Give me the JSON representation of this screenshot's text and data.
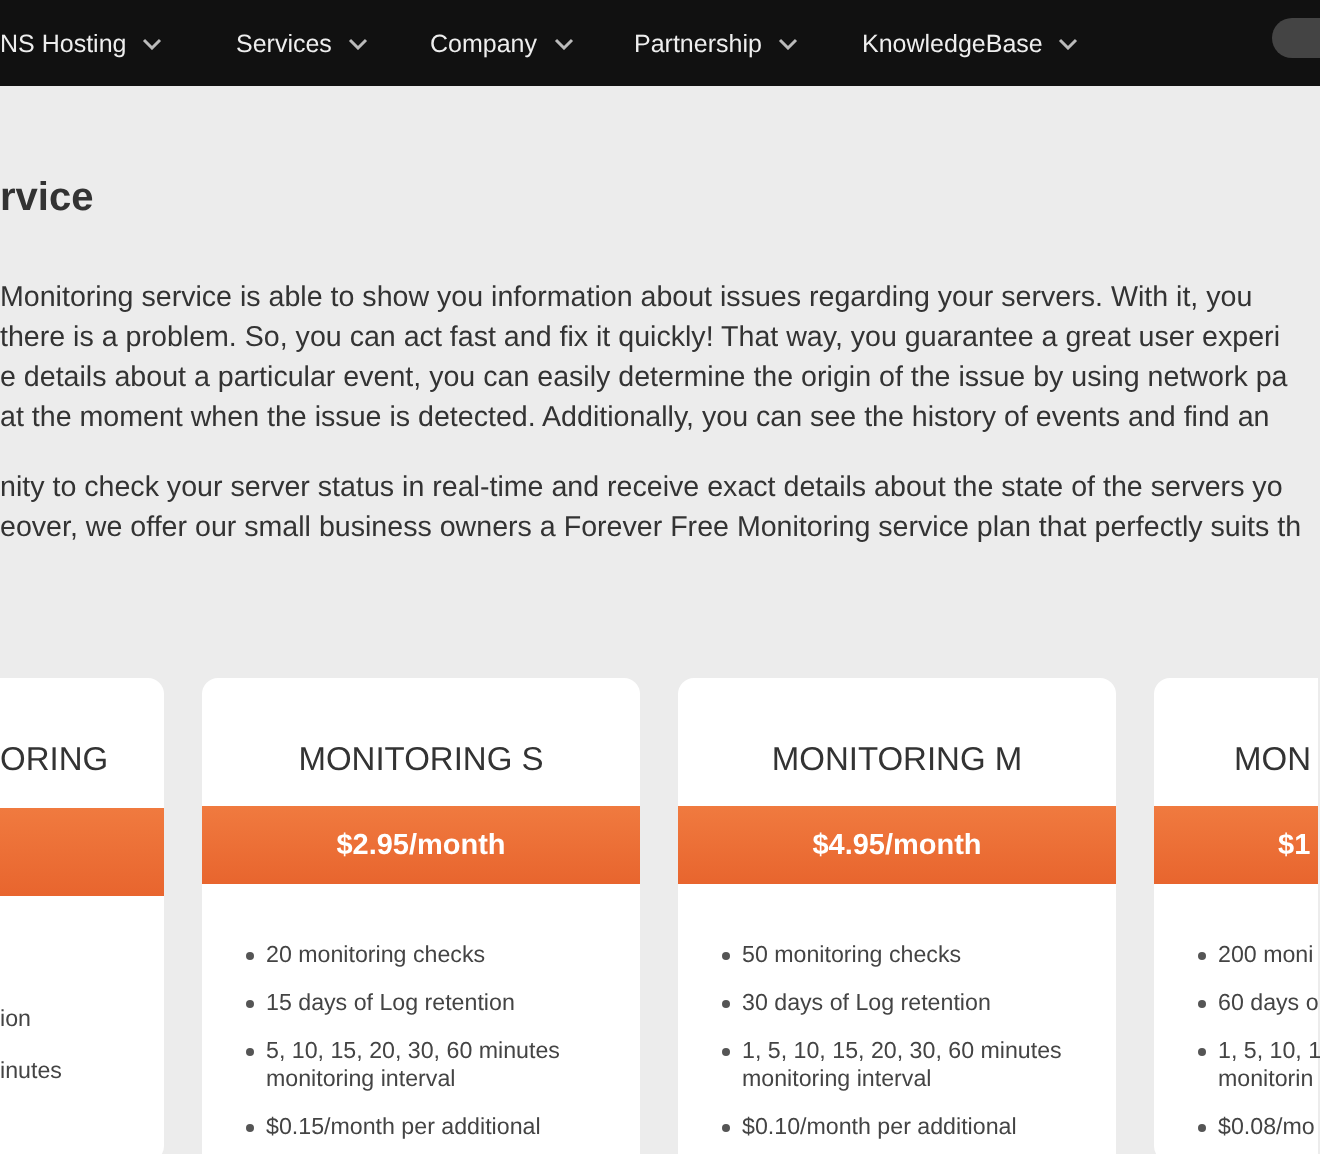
{
  "nav": {
    "items": [
      {
        "label": "NS Hosting"
      },
      {
        "label": "Services"
      },
      {
        "label": "Company"
      },
      {
        "label": "Partnership"
      },
      {
        "label": "KnowledgeBase"
      }
    ]
  },
  "page_title": "rvice",
  "paragraphs": [
    {
      "lines": [
        "Monitoring service is able to show you information about issues regarding your servers. With it, you",
        "there is a problem. So, you can act fast and fix it quickly! That way, you guarantee a great user experi",
        "e details about a particular event, you can easily determine the origin of the issue by using network pa",
        "at the moment when the issue is detected. Additionally, you can see the history of events and find an"
      ]
    },
    {
      "lines": [
        "nity to check your server status in real-time and receive exact details about the state of the servers yo",
        "eover, we offer our small business owners a Forever Free Monitoring service plan that perfectly suits th"
      ]
    }
  ],
  "plans": [
    {
      "kind": "left",
      "title": "ORING",
      "features": [
        {
          "lines": [
            "ion"
          ]
        },
        {
          "lines": [
            "inutes"
          ]
        }
      ]
    },
    {
      "kind": "full",
      "title": "MONITORING S",
      "price": "$2.95/month",
      "features": [
        {
          "lines": [
            "20 monitoring checks"
          ]
        },
        {
          "lines": [
            "15 days of Log retention"
          ]
        },
        {
          "lines": [
            "5, 10, 15, 20, 30, 60 minutes",
            "monitoring interval"
          ]
        },
        {
          "lines": [
            "$0.15/month per additional"
          ]
        }
      ]
    },
    {
      "kind": "full",
      "title": "MONITORING M",
      "price": "$4.95/month",
      "features": [
        {
          "lines": [
            "50 monitoring checks"
          ]
        },
        {
          "lines": [
            "30 days of Log retention"
          ]
        },
        {
          "lines": [
            "1, 5, 10, 15, 20, 30, 60 minutes",
            "monitoring interval"
          ]
        },
        {
          "lines": [
            "$0.10/month per additional"
          ]
        }
      ]
    },
    {
      "kind": "right",
      "title": "MON",
      "price": "$1",
      "features": [
        {
          "lines": [
            "200 moni"
          ]
        },
        {
          "lines": [
            "60 days o"
          ]
        },
        {
          "lines": [
            "1, 5, 10, 1",
            "monitorin"
          ]
        },
        {
          "lines": [
            "$0.08/mo"
          ]
        }
      ]
    }
  ]
}
